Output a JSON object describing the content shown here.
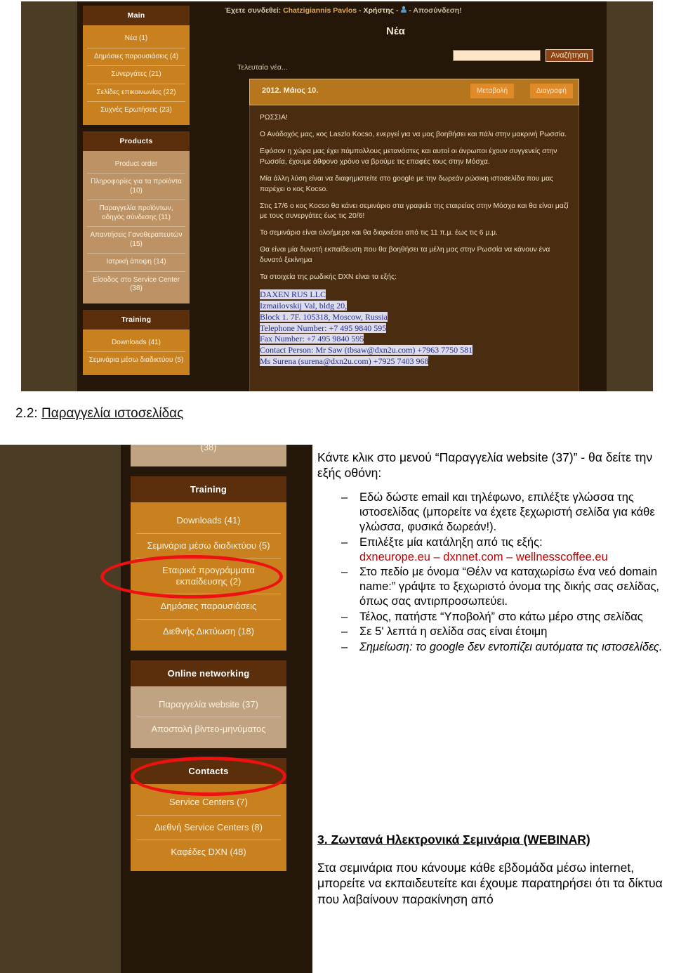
{
  "top_screenshot": {
    "header": {
      "logged_in_prefix": "Έχετε συνδεθεί:",
      "user_name": "Chatzigiannis Pavlos",
      "role": "Χρήστης",
      "separator": "-",
      "logout": "Αποσύνδεση!",
      "avatar_icon": "user-avatar-icon",
      "page_title": "Νέα",
      "search_value": "",
      "search_placeholder": "",
      "search_button": "Αναζήτηση"
    },
    "latest_label": "Τελευταία νέα...",
    "news": {
      "date": "2012. Μάιος 10.",
      "edit_button": "Μεταβολή",
      "delete_button": "Διαγραφή",
      "paragraphs": [
        "ΡΩΣΣΙΑ!",
        "Ο Ανάδοχός μας, κος Laszlo Kocso, ενεργεί για να μας βοηθήσει και πάλι στην μακρινή Ρωσσία.",
        "Εφόσον η χώρα μας έχει πάμπολλους μετανάστες και αυτοί οι άνρωποι έχουν συγγενείς στην Ρωσσία, έχουμε άθφονο χρόνο να βρούμε τις επαφές τους στην Μόσχα.",
        "Μία άλλη λύση είναι να διαφημιστείτε στο google με την δωρεάν ρώσικη ιστοσελίδα που μας παρέχει ο κος Kocso.",
        "Στις 17/6 ο κος Kocso θα κάνει σεμινάριο στα γραφεία της εταιρείας στην Μόσχα και θα είναι μαζί με τους συνεργάτες έως τις 20/6!",
        "Το σεμινάριο είναι ολοήμερο και θα διαρκέσει από τις 11 π.μ. έως τις 6 μ.μ.",
        "Θα είναι μία δυνατή εκπαίδευση που θα βοηθήσει τα μέλη μας στην Ρωσσία να κάνουν ένα δυνατό ξεκίνημα",
        "Τα στοιχεία της ρωδικής DXN είναι τα εξής:"
      ],
      "address_lines": [
        "DAXEN RUS LLC",
        "Izmailovskij Val, bldg 20,",
        "Block 1. 7F. 105318, Moscow, Russia",
        "Telephone Number: +7 495 9840 595",
        "Fax Number: +7 495 9840 595",
        "Contact Person: Mr Saw (tbsaw@dxn2u.com) +7963 7750 581",
        "Ms Surena (surena@dxn2u.com) +7925 7403 968"
      ]
    },
    "sidebar": [
      {
        "title": "Main",
        "style": "orange",
        "items": [
          "Νέα (1)",
          "Δημόσιες παρουσιάσεις (4)",
          "Συνεργάτες (21)",
          "Σελίδες επικοινωνίας (22)",
          "Συχνές Ερωτήσεις (23)"
        ]
      },
      {
        "title": "Products",
        "style": "tan",
        "items": [
          "Product order",
          "Πληροφορίες για τα προϊόντα (10)",
          "Παραγγελία προϊόντων, οδηγός σύνδεσης (11)",
          "Απαντήσεις Γανοθεραπευτών (15)",
          "Ιατρική άποψη (14)",
          "Είσοδος στο Service Center (38)"
        ]
      },
      {
        "title": "Training",
        "style": "orange",
        "items": [
          "Downloads (41)",
          "Σεμινάρια μέσω διαδικτύου (5)"
        ]
      }
    ]
  },
  "section_heading": {
    "number": "2.2: ",
    "title": "Παραγγελία ιστοσελίδας"
  },
  "bottom_screenshot": {
    "sidebar": [
      {
        "title": "",
        "style": "lighttan",
        "items": [
          "(38)"
        ]
      },
      {
        "title": "Training",
        "style": "orange",
        "items": [
          "Downloads (41)",
          "Σεμινάρια μέσω διαδικτύου (5)",
          "Εταιρικά προγράμματα εκπαίδευσης (2)",
          "Δημόσιες παρουσιάσεις",
          "Διεθνής Δικτύωση (18)"
        ]
      },
      {
        "title": "Online networking",
        "style": "lighttan",
        "items": [
          "Παραγγελία website (37)",
          "Αποστολή βίντεο-μηνύματος"
        ]
      },
      {
        "title": "Contacts",
        "style": "orange",
        "items": [
          "Service Centers (7)",
          "Διεθνή Service Centers (8)",
          "Καφέδες DXN (48)"
        ]
      }
    ],
    "annotations": {
      "ellipse_1_target": "Σεμινάρια μέσω διαδικτύου (5)",
      "ellipse_2_target": "Παραγγελία website (37)",
      "ellipse_color": "#ee1111"
    }
  },
  "doc": {
    "lead": "Κάντε κλικ στο μενού “Παραγγελία website (37)” - θα δείτε την εξής οθόνη:",
    "bullets": [
      {
        "text": "Εδώ δώστε email και τηλέφωνο, επιλέξτε γλώσσα της ιστοσελίδας (μπορείτε να έχετε ξεχωριστή σελίδα για κάθε γλώσσα, φυσικά δωρεάν!).",
        "style": "plain"
      },
      {
        "text": "Επιλέξτε μία κατάληξη από τις εξής: ",
        "red_text": "dxneurope.eu – dxnnet.com – wellnesscoffee.eu",
        "style": "plain-with-red"
      },
      {
        "text": "Στο πεδίο με όνομα “Θέλν να καταχωρίσω ένα νεό domain name:” γράψτε το ξεχωριστό όνομα της δικής σας σελίδας, όπως σας αντιρπροσωπεύει.",
        "style": "plain"
      },
      {
        "text": "Τέλος, πατήστε “Υποβολή” στο κάτω μέρο στης σελίδας",
        "style": "plain"
      },
      {
        "text": "Σε 5' λεπτά η σελίδα σας είναι έτοιμη",
        "style": "plain"
      },
      {
        "text": "Σημείωση: το google δεν εντοπίζει αυτόματα τις ιστοσελίδες.",
        "style": "italic"
      }
    ]
  },
  "section3": {
    "heading": "3. Ζωντανά Ηλεκτρονικά Σεμινάρια (WEBINAR)",
    "body": "Στα σεμινάρια που κάνουμε κάθε εβδομάδα μέσω internet, μπορείτε να εκπαιδευτείτε και έχουμε παρατηρήσει ότι τα δίκτυα που λαβαίνουν παρακίνηση από"
  }
}
